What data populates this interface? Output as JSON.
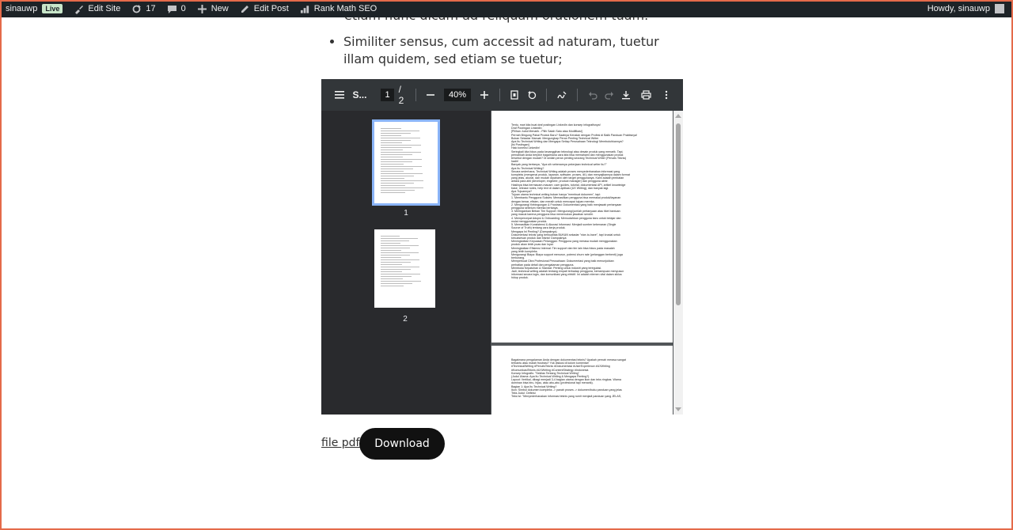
{
  "adminbar": {
    "site_name": "sinauwp",
    "live_badge": "Live",
    "edit_site": "Edit Site",
    "updates_count": "17",
    "comments_count": "0",
    "new_label": "New",
    "edit_post": "Edit Post",
    "rank_math": "Rank Math SEO",
    "howdy": "Howdy, sinauwp"
  },
  "content": {
    "prev_line": "etiam nunc dicam ad reliquam orationem tuam.",
    "bullet": "Similiter sensus, cum accessit ad naturam, tuetur illam quidem, sed etiam se tuetur;"
  },
  "viewer": {
    "title": "S...",
    "page_current": "1",
    "page_total": "/ 2",
    "zoom": "40%",
    "thumbs": [
      "1",
      "2"
    ],
    "page1_lines": [
      "Tentu, mari kita buat draf postingan LinkedIn dan konsep infografisnya!",
      "Draf Postingan LinkedIn:",
      "[Pilihan Judul Menarik - Pilih Salah Satu atau Modifikasi]",
      "Pernah Bingung Pakai Produk Baru? Saatnya Kenalan dengan Profesi di Balik Panduan Praktisnya!",
      "Bukan Sekadar Manual: Mengungkap Peran Penting Technical Writer",
      "Apa Itu Technical Writing dan Mengapa Setiap Perusahaan Teknologi Membutuhkannya?",
      "[Isi Postingan]",
      "Halo koneksi LinkedIn!",
      "Seringkali kita fokus pada kecanggihan teknologi atau desain produk yang menarik. Tapi,",
      "pernahkah Anda berpikir bagaimana cara kita bisa memahami dan menggunakan produk",
      "tersebut dengan mudah? Di sinilah peran penting seorang Technical Writer (Penulis Teknis)",
      "hadir!",
      "Banyak yang bertanya, \"Apa sih sebenarnya pekerjaan technical writer itu?\"",
      "Apa Itu Technical Writing?",
      "Secara sederhana, Technical Writing adalah proses menyederhanakan informasi yang",
      "kompleks (mengenai produk, layanan, software, proses, dll.) dan menyajikannya dalam format",
      "yang jelas, akurat, dan mudah dipahami oleh target penggunanya. Kami adalah jembatan",
      "antara para ahli (developer, engineer, product manager) dan pengguna akhir.",
      "Hasilnya bisa bermacam-macam: user guides, tutorial, dokumentasi API, artikel knowledge",
      "base, release notes, help text di dalam aplikasi (UX Writing), dan banyak lagi.",
      "Apa Tujuannya?",
      "Tujuan utama technical writing bukan hanya \"membuat dokumen\", tapi:",
      "1. Membantu Pengguna Sukses: Memastikan pengguna bisa memakai produk/layanan",
      "dengan benar, efisien, dan meraih untuk mencapai tujuan mereka.",
      "2. Mengurangi Kebingungan & Frustrasi: Dokumentasi yang baik menjawab pertanyaan",
      "pengguna sebelum mereka bertanya.",
      "3. Meringankan Beban Tim Support: Mengurangi jumlah pertanyaan atau tiket bantuan",
      "yang masuk karena pengguna bisa menemukan jawaban sendiri.",
      "4. Mempercepat Adopsi & Onboarding: Memudahkan pengguna baru untuk belajar dan",
      "mulai menggunakan produk.",
      "5. Memastikan Konsistensi & Akurasi Informasi: Menjadi sumber kebenaran (Single",
      "Source of Truth) tentang cara kerja produk.",
      "Mengapa Ini Penting? (Dampaknya)",
      "Dokumentasi teknis yang berkualitas BUKAN sekadar \"nice-to-have\", tapi krusial untuk",
      "kesuksesan produk dan bisnis! Dampaknya:",
      "Meningkatkan Kepuasan Pelanggan: Pengguna yang merasa mudah menggunakan",
      "produk akan lebih puas dan loyal.",
      "Meningkatkan Efisiensi Internal: Tim support dan tim lain bisa fokus pada masalah",
      "yang lebih kompleks.",
      "Mengurangi Biaya: Biaya support menurun, potensi churn rate (pelanggan berhenti) juga",
      "berkurang.",
      "Memperkuat Citra Profesional Perusahaan: Dokumentasi yang baik menunjukkan",
      "perhatian pada detail dan pengalaman pengguna.",
      "Membuka Kepatuhan & Standar: Penting untuk industri yang teregulasi.",
      "Jadi, technical writing adalah tentang empati terhadap pengguna, kemampuan menyusun",
      "informasi secara logis, dan komunikasi yang efektif. Ini adalah elemen vital dalam siklus",
      "hidup produk."
    ],
    "page2_lines": [
      "Bagaimana pengalaman Anda dengan dokumentasi teknis? Apakah pernah merasa sangat",
      "terbantu atau malah frustrasi? Yuk diskusi di kolom komentar!",
      "#TechnicalWriting #PenulisTeknis #Dokumentasi #UserExperience #UXWriting",
      "#KomunikasiTeknis #UXWriting #ContentStrategy #Indonesia",
      "Konsep Infografis: \"Sekilas Tentang Technical Writing\"",
      "(Judul Utama: Apa Itu Technical Writing & Mengapa Penting?)",
      "Layout: Vertikal, dibagi menjadi 3-4 bagian utama dengan ikon dan teks ringkas. Warna",
      "dominan bisa biru, hijau, atau abu-abu (profesional tapi menarik).",
      "Bagian 1: Apa Itu Technical Writing?",
      "Ikon: Simbol dokumen kompleks -> panah proses -> dokumen/buku panduan yang jelas",
      "Teks Judul: Definisi",
      "Teks Isi: \"Menyederhanakan informasi teknis yang rumit menjadi panduan yang JELAS,"
    ]
  },
  "footer": {
    "file_link": "file pdf",
    "download": "Download"
  }
}
